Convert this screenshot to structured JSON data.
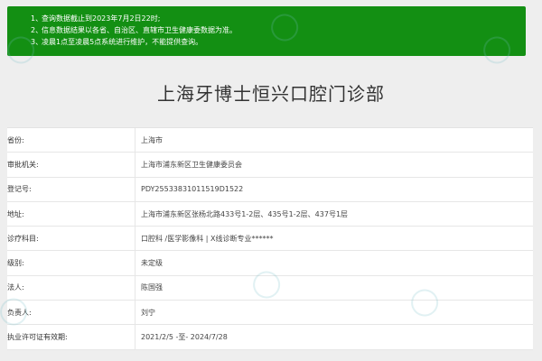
{
  "notice": {
    "lines": [
      {
        "num": "1、",
        "text": "查询数据截止到2023年7月2日22时;"
      },
      {
        "num": "2、",
        "text": "信息数据结果以各省、自治区、直辖市卫生健康委数据为准。"
      },
      {
        "num": "3、",
        "text": "凌晨1点至凌晨5点系统进行维护，不能提供查询。"
      }
    ]
  },
  "title": "上海牙博士恒兴口腔门诊部",
  "rows": [
    {
      "label": "省份:",
      "value": "上海市"
    },
    {
      "label": "审批机关:",
      "value": "上海市浦东新区卫生健康委员会"
    },
    {
      "label": "登记号:",
      "value": "PDY25533831011519D1522"
    },
    {
      "label": "地址:",
      "value": "上海市浦东新区张杨北路433号1-2层、435号1-2层、437号1层"
    },
    {
      "label": "诊疗科目:",
      "value": "口腔科 /医学影像科 | X线诊断专业******"
    },
    {
      "label": "级别:",
      "value": "未定级"
    },
    {
      "label": "法人:",
      "value": "陈国强"
    },
    {
      "label": "负责人:",
      "value": "刘宁"
    },
    {
      "label": "执业许可证有效期:",
      "value": "2021/2/5 -至- 2024/7/28"
    }
  ],
  "colors": {
    "notice_bg": "#138f13",
    "background": "#eeeeee"
  }
}
